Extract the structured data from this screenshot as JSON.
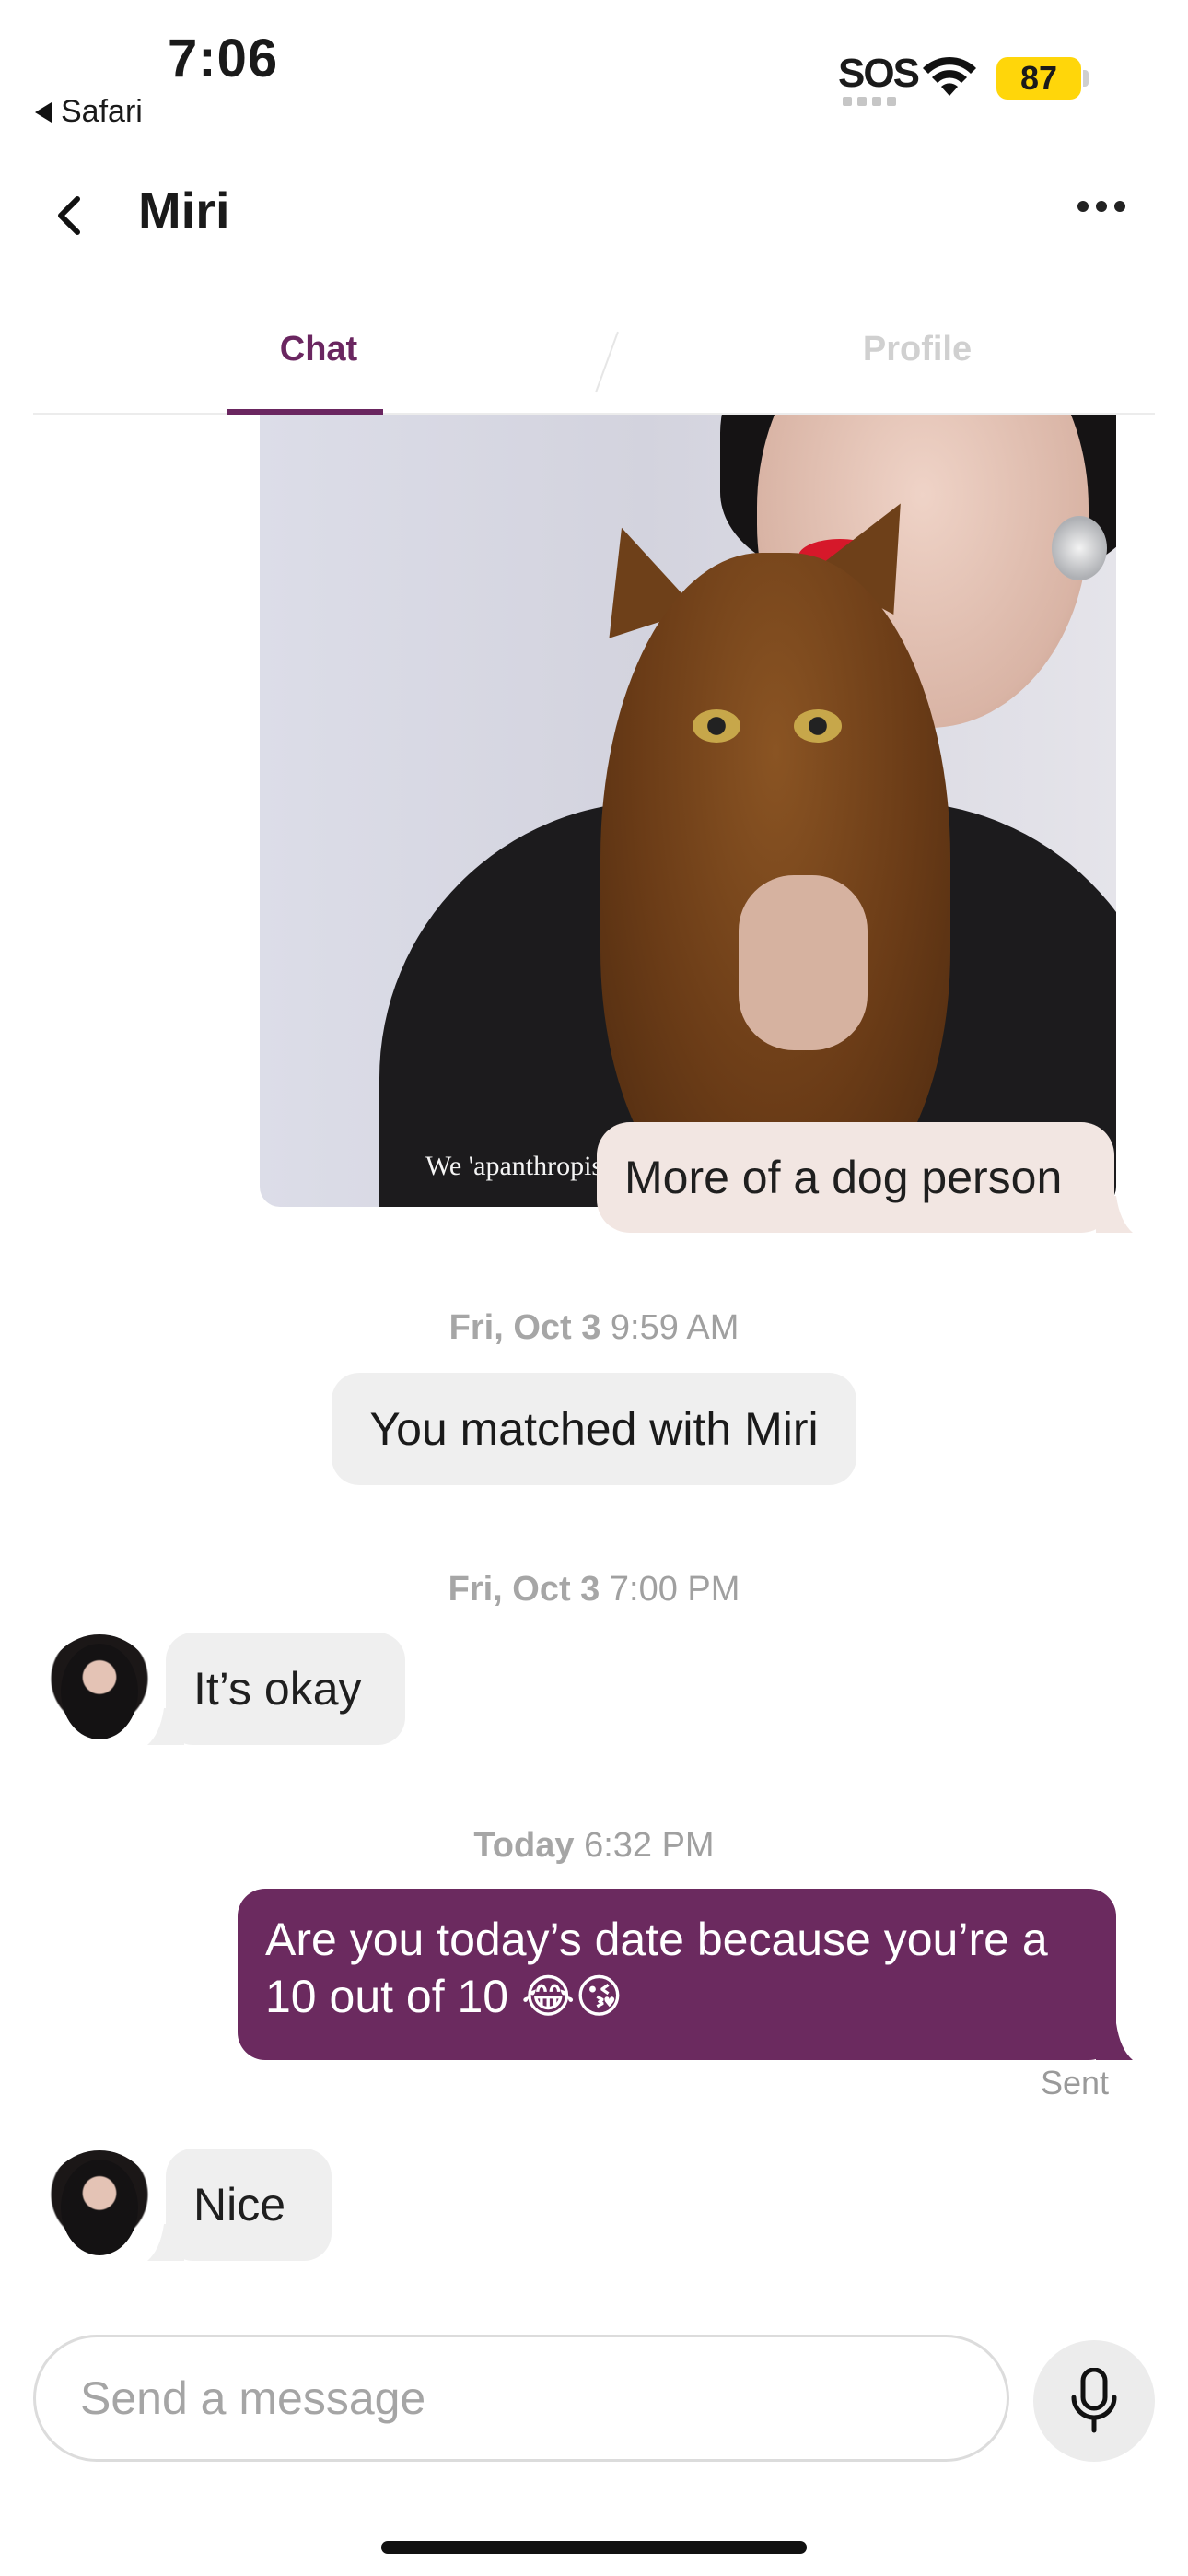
{
  "status_bar": {
    "time": "7:06",
    "back_app": "Safari",
    "sos": "SOS",
    "battery": "87",
    "battery_color": "#ffd60a"
  },
  "header": {
    "title": "Miri",
    "back_icon": "chevron-left-icon",
    "more_icon": "more-horizontal-icon"
  },
  "tabs": [
    {
      "label": "Chat",
      "active": true
    },
    {
      "label": "Profile",
      "active": false
    }
  ],
  "colors": {
    "accent": "#6a2660",
    "outgoing_bubble": "#6b2a5f",
    "incoming_bubble": "#efefef",
    "image_reply_bubble": "#f2e6e2"
  },
  "messages": {
    "photo_reply": "More of a dog person",
    "photo_caption_fragment": "We 'apanthropist",
    "ts1_day": "Fri, Oct 3",
    "ts1_time": "9:59 AM",
    "match_notice": "You matched with Miri",
    "ts2_day": "Fri, Oct 3",
    "ts2_time": "7:00 PM",
    "incoming_1": "It’s okay",
    "ts3_day": "Today",
    "ts3_time": "6:32 PM",
    "outgoing_1": "Are you today’s date because you’re a 10 out of 10 😂😘",
    "outgoing_1_status": "Sent",
    "incoming_2": "Nice"
  },
  "composer": {
    "placeholder": "Send a message",
    "mic_icon": "microphone-icon"
  }
}
